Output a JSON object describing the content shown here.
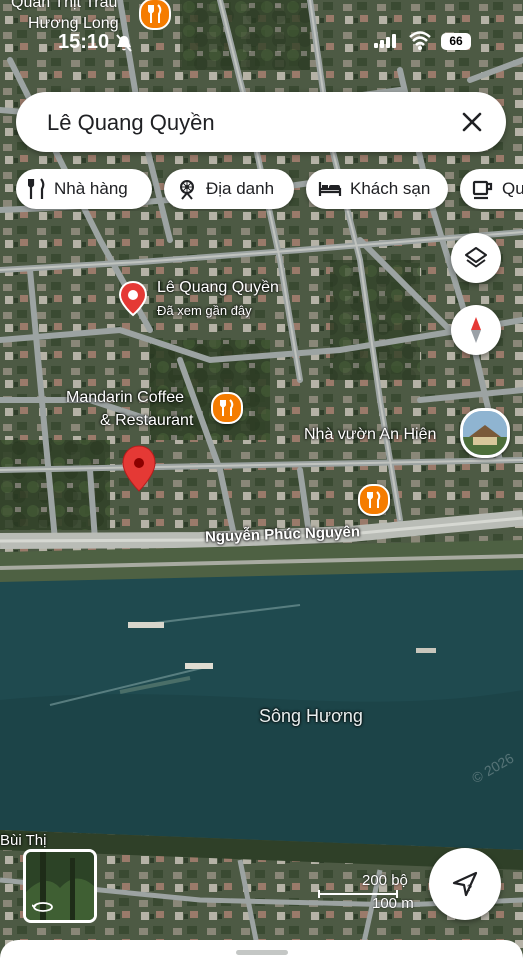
{
  "status_bar": {
    "time": "15:10",
    "battery": "66",
    "top_place_1": "Quán Thịt Trâu",
    "top_place_2": "Hương Long"
  },
  "search": {
    "query": "Lê Quang Quyền",
    "close_icon": "close-icon"
  },
  "chips": [
    {
      "label": "Nhà hàng",
      "icon": "restaurant-icon"
    },
    {
      "label": "Địa danh",
      "icon": "landmark-icon"
    },
    {
      "label": "Khách sạn",
      "icon": "hotel-icon"
    },
    {
      "label": "Quán cà phê",
      "icon": "coffee-icon"
    }
  ],
  "map": {
    "places": {
      "searched": {
        "title": "Lê Quang Quyền",
        "subtitle": "Đã xem gần đây"
      },
      "mandarin": {
        "line1": "Mandarin Coffee",
        "line2": "& Restaurant"
      },
      "garden": "Nhà vườn An Hiên",
      "street": "Nguyễn Phúc Nguyên",
      "river": "Sông Hương",
      "bottom_left": "Bùi Thị"
    },
    "watermark": "© 2026",
    "scale": {
      "imperial": "200 bộ",
      "metric": "100 m"
    }
  },
  "controls": {
    "layers_icon": "layers-icon",
    "compass_icon": "compass-icon",
    "directions_icon": "directions-icon"
  },
  "colors": {
    "pin_red": "#e53935",
    "food_orange": "#f57c00",
    "river": "#1f4a4f"
  }
}
